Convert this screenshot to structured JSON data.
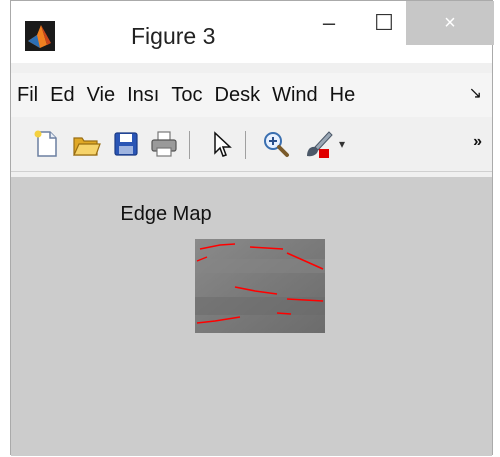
{
  "window": {
    "title": "Figure 3",
    "controls": {
      "minimize": "–",
      "maximize": "☐",
      "close": "×"
    }
  },
  "menubar": {
    "items": [
      "Fil",
      "Ed",
      "Vie",
      "Insı",
      "Toc",
      "Desk",
      "Wind",
      "He"
    ],
    "overflow_glyph": "↘"
  },
  "toolbar": {
    "buttons": [
      "new-figure-icon",
      "open-file-icon",
      "save-icon",
      "print-icon",
      "pointer-icon",
      "zoom-in-icon",
      "brush-icon"
    ],
    "dropdown_glyph": "▾",
    "overflow_glyph": "»"
  },
  "figure": {
    "axes_title": "Edge Map",
    "background": "#cccccc",
    "edge_color": "#ff0000"
  }
}
